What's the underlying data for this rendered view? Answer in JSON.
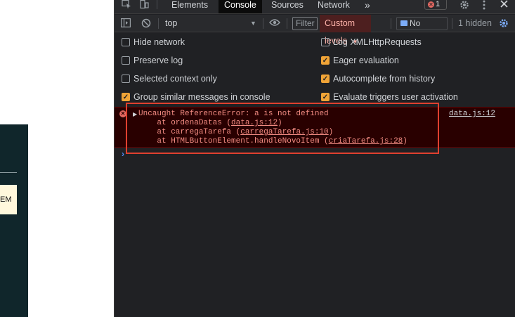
{
  "page": {
    "button_text": "EM"
  },
  "devtools": {
    "tabs": [
      "Elements",
      "Console",
      "Sources",
      "Network"
    ],
    "active_tab": "Console",
    "more_tabs": "»",
    "error_count": "1",
    "toolbar": {
      "context": "top",
      "filter_placeholder": "Filter",
      "custom_levels": "Custom levels",
      "no_issues": "No Issues",
      "hidden": "1 hidden"
    },
    "settings": {
      "left": [
        {
          "label": "Hide network",
          "checked": false
        },
        {
          "label": "Preserve log",
          "checked": false
        },
        {
          "label": "Selected context only",
          "checked": false
        },
        {
          "label": "Group similar messages in console",
          "checked": true
        }
      ],
      "right": [
        {
          "label": "Log XMLHttpRequests",
          "checked": false
        },
        {
          "label": "Eager evaluation",
          "checked": true
        },
        {
          "label": "Autocomplete from history",
          "checked": true
        },
        {
          "label": "Evaluate triggers user activation",
          "checked": true
        }
      ]
    },
    "error": {
      "message": "Uncaught ReferenceError: a is not defined",
      "source": "data.js:12",
      "stack": [
        {
          "prefix": "    at ordenaDatas (",
          "link": "data.js:12",
          "suffix": ")"
        },
        {
          "prefix": "    at carregaTarefa (",
          "link": "carregaTarefa.js:10",
          "suffix": ")"
        },
        {
          "prefix": "    at HTMLButtonElement.handleNovoItem (",
          "link": "criaTarefa.js:28",
          "suffix": ")"
        }
      ]
    },
    "prompt": "›"
  },
  "colors": {
    "devtools_bg": "#202124",
    "error_bg": "#290000",
    "error_text": "#f28b82",
    "highlight": "#e0402f",
    "checkbox_on": "#f0a437"
  }
}
